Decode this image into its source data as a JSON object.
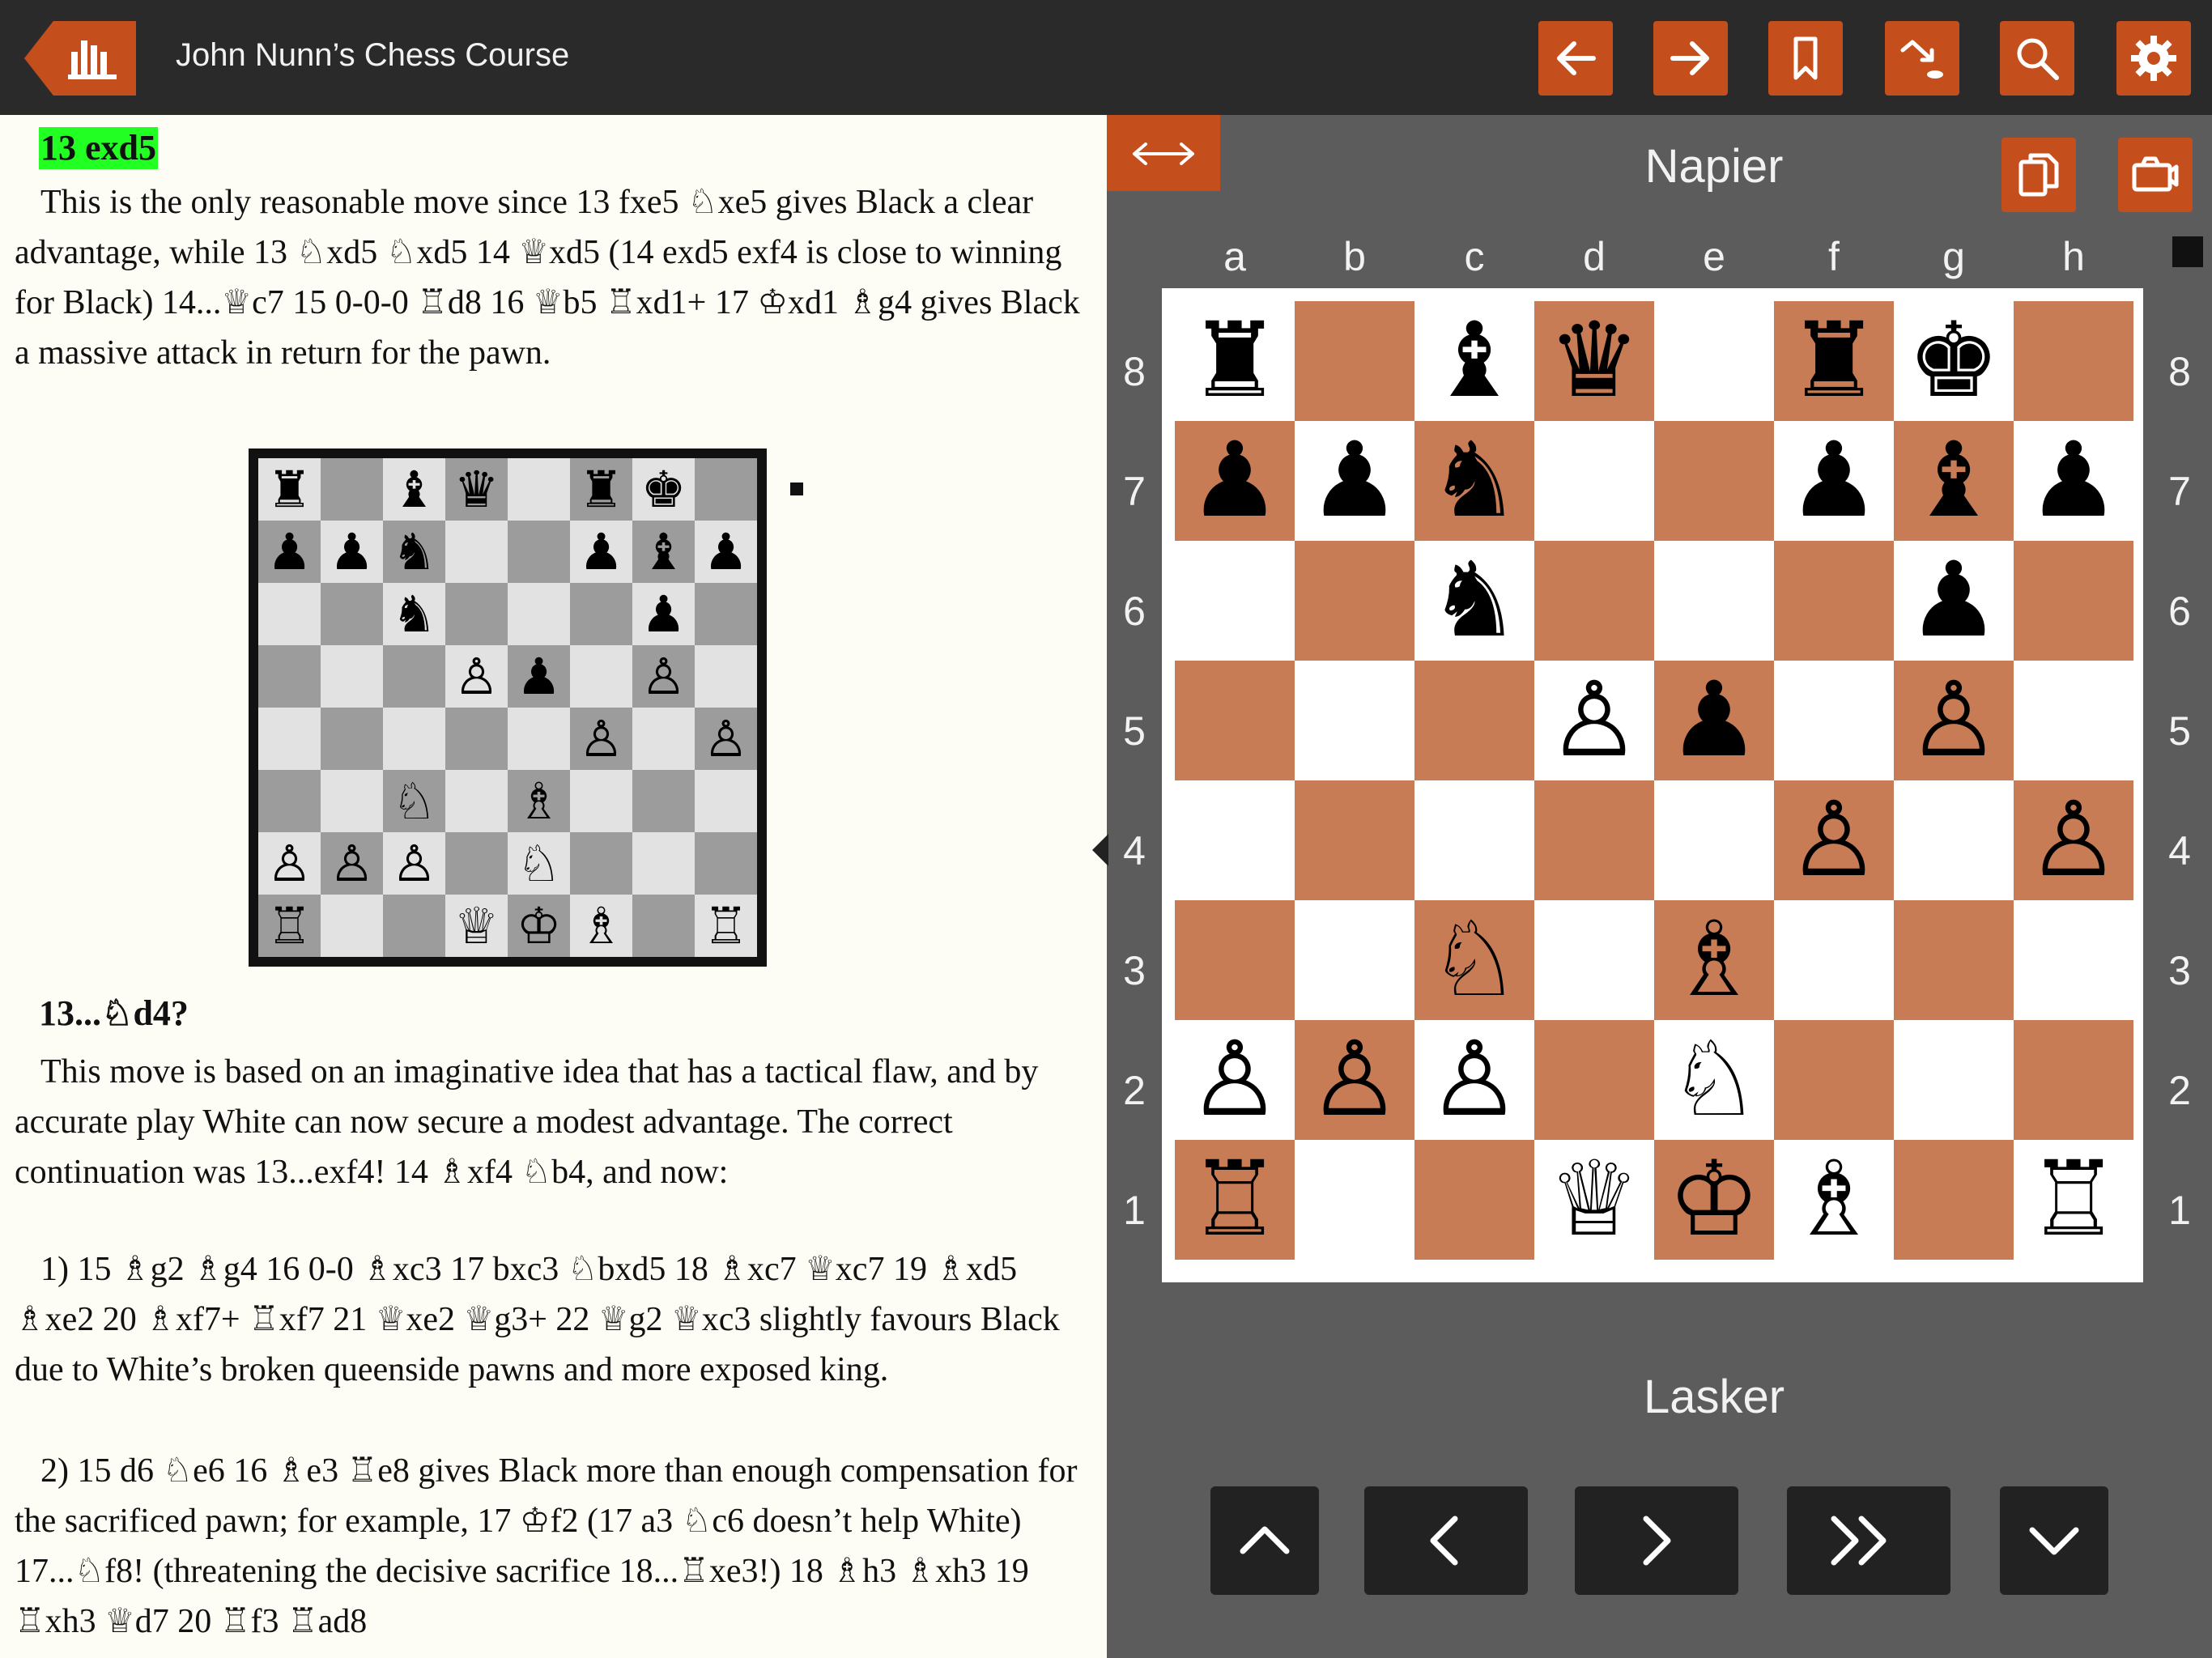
{
  "header": {
    "title": "John Nunn’s Chess Course",
    "icons": [
      "book-shelf-icon",
      "arrow-left-icon",
      "arrow-right-icon",
      "bookmark-icon",
      "goto-arrow-icon",
      "search-icon",
      "gear-icon"
    ]
  },
  "colors": {
    "accent": "#c44f1c",
    "topbar": "#2a2a2a",
    "panel": "#5c5c5c",
    "dark_square": "#c87c56",
    "light_square": "#ffffff",
    "highlight": "#22ff22"
  },
  "text": {
    "move_13": "13 exd5",
    "para_1": "This is the only reasonable move since 13 fxe5 ♘xe5 gives Black a clear advantage, while 13 ♘xd5 ♘xd5 14 ♕xd5 (14 exd5 exf4 is close to winning for Black) 14...♕c7 15 0-0-0 ♖d8 16 ♕b5 ♖xd1+ 17 ♔xd1 ♗g4 gives Black a massive attack in return for the pawn.",
    "move_13b": "13...♘d4?",
    "para_2": "This move is based on an imaginative idea that has a tactical flaw, and by accurate play White can now secure a modest advantage. The correct continuation was 13...exf4! 14 ♗xf4 ♘b4, and now:",
    "para_3": "1) 15 ♗g2 ♗g4 16 0-0 ♗xc3 17 bxc3 ♘bxd5 18 ♗xc7 ♕xc7 19 ♗xd5 ♗xe2 20 ♗xf7+ ♖xf7 21 ♕xe2 ♕g3+ 22 ♕g2 ♕xc3 slightly favours Black due to White’s broken queenside pawns and more exposed king.",
    "para_4": "2) 15 d6 ♘e6 16 ♗e3 ♖e8 gives Black more than enough compensation for the sacrificed pawn; for example, 17 ♔f2 (17 a3 ♘c6 doesn’t help White) 17...♘f8! (threatening the decisive sacrifice 18...♖xe3!) 18 ♗h3 ♗xh3 19 ♖xh3 ♕d7 20 ♖f3 ♖ad8"
  },
  "board": {
    "black_player": "Napier",
    "white_player": "Lasker",
    "files": [
      "a",
      "b",
      "c",
      "d",
      "e",
      "f",
      "g",
      "h"
    ],
    "ranks": [
      "8",
      "7",
      "6",
      "5",
      "4",
      "3",
      "2",
      "1"
    ],
    "position": [
      [
        "♜",
        "",
        "♝",
        "♛",
        "",
        "♜",
        "♚",
        ""
      ],
      [
        "♟",
        "♟",
        "♞",
        "",
        "",
        "♟",
        "♝",
        "♟"
      ],
      [
        "",
        "",
        "♞",
        "",
        "",
        "",
        "♟",
        ""
      ],
      [
        "",
        "",
        "",
        "♙",
        "♟",
        "",
        "♙",
        ""
      ],
      [
        "",
        "",
        "",
        "",
        "",
        "♙",
        "",
        "♙"
      ],
      [
        "",
        "",
        "♘",
        "",
        "♗",
        "",
        "",
        ""
      ],
      [
        "♙",
        "♙",
        "♙",
        "",
        "♘",
        "",
        "",
        ""
      ],
      [
        "♖",
        "",
        "",
        "♕",
        "♔",
        "♗",
        "",
        "♖"
      ]
    ],
    "icons": [
      "flip-board-icon",
      "copy-icon",
      "camera-icon"
    ]
  },
  "nav": {
    "icons": [
      "first-move-icon",
      "previous-move-icon",
      "next-move-icon",
      "play-forward-icon",
      "last-move-icon"
    ]
  }
}
